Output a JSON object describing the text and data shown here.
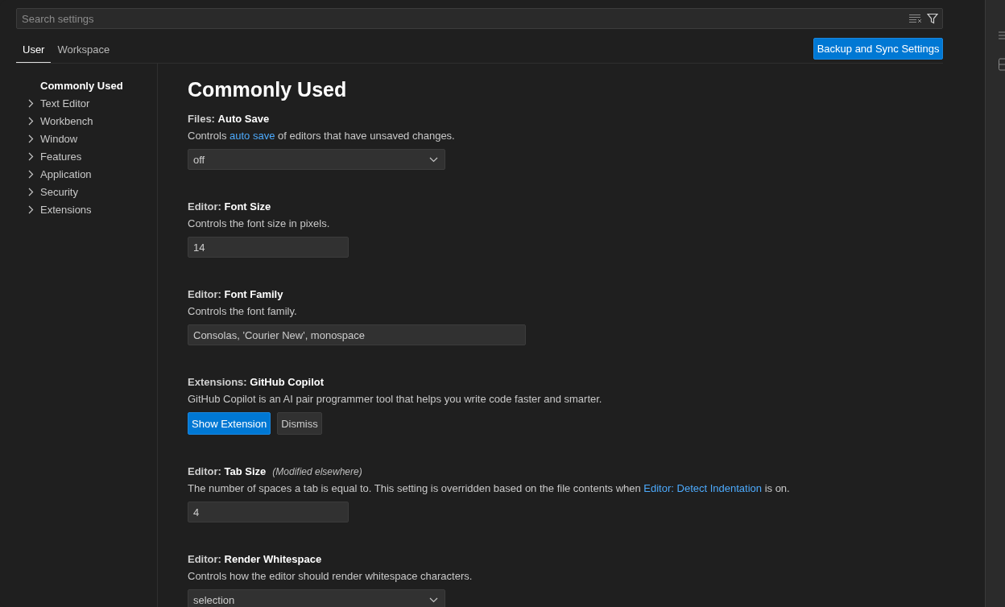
{
  "search": {
    "placeholder": "Search settings"
  },
  "tabs": [
    {
      "label": "User",
      "selected": true
    },
    {
      "label": "Workspace",
      "selected": false
    }
  ],
  "sync_button": "Backup and Sync Settings",
  "toc": [
    {
      "label": "Commonly Used",
      "selected": true,
      "expandable": false
    },
    {
      "label": "Text Editor",
      "selected": false,
      "expandable": true
    },
    {
      "label": "Workbench",
      "selected": false,
      "expandable": true
    },
    {
      "label": "Window",
      "selected": false,
      "expandable": true
    },
    {
      "label": "Features",
      "selected": false,
      "expandable": true
    },
    {
      "label": "Application",
      "selected": false,
      "expandable": true
    },
    {
      "label": "Security",
      "selected": false,
      "expandable": true
    },
    {
      "label": "Extensions",
      "selected": false,
      "expandable": true
    }
  ],
  "heading": "Commonly Used",
  "settings": [
    {
      "kind": "dropdown",
      "category": "Files:",
      "title": "Auto Save",
      "description": [
        {
          "text": "Controls ",
          "link": false
        },
        {
          "text": "auto save",
          "link": true
        },
        {
          "text": " of editors that have unsaved changes.",
          "link": false
        }
      ],
      "value": "off"
    },
    {
      "kind": "number",
      "category": "Editor:",
      "title": "Font Size",
      "description": [
        {
          "text": "Controls the font size in pixels.",
          "link": false
        }
      ],
      "value": "14"
    },
    {
      "kind": "text",
      "category": "Editor:",
      "title": "Font Family",
      "description": [
        {
          "text": "Controls the font family.",
          "link": false
        }
      ],
      "value": "Consolas, 'Courier New', monospace"
    },
    {
      "kind": "buttons",
      "category": "Extensions:",
      "title": "GitHub Copilot",
      "description": [
        {
          "text": "GitHub Copilot is an AI pair programmer tool that helps you write code faster and smarter.",
          "link": false
        }
      ],
      "buttons": [
        {
          "label": "Show Extension",
          "primary": true
        },
        {
          "label": "Dismiss",
          "primary": false
        }
      ]
    },
    {
      "kind": "number",
      "category": "Editor:",
      "title": "Tab Size",
      "note": "(Modified elsewhere)",
      "description": [
        {
          "text": "The number of spaces a tab is equal to. This setting is overridden based on the file contents when ",
          "link": false
        },
        {
          "text": "Editor: Detect Indentation",
          "link": true
        },
        {
          "text": " is on.",
          "link": false
        }
      ],
      "value": "4"
    },
    {
      "kind": "dropdown",
      "category": "Editor:",
      "title": "Render Whitespace",
      "description": [
        {
          "text": "Controls how the editor should render whitespace characters.",
          "link": false
        }
      ],
      "value": "selection"
    }
  ]
}
